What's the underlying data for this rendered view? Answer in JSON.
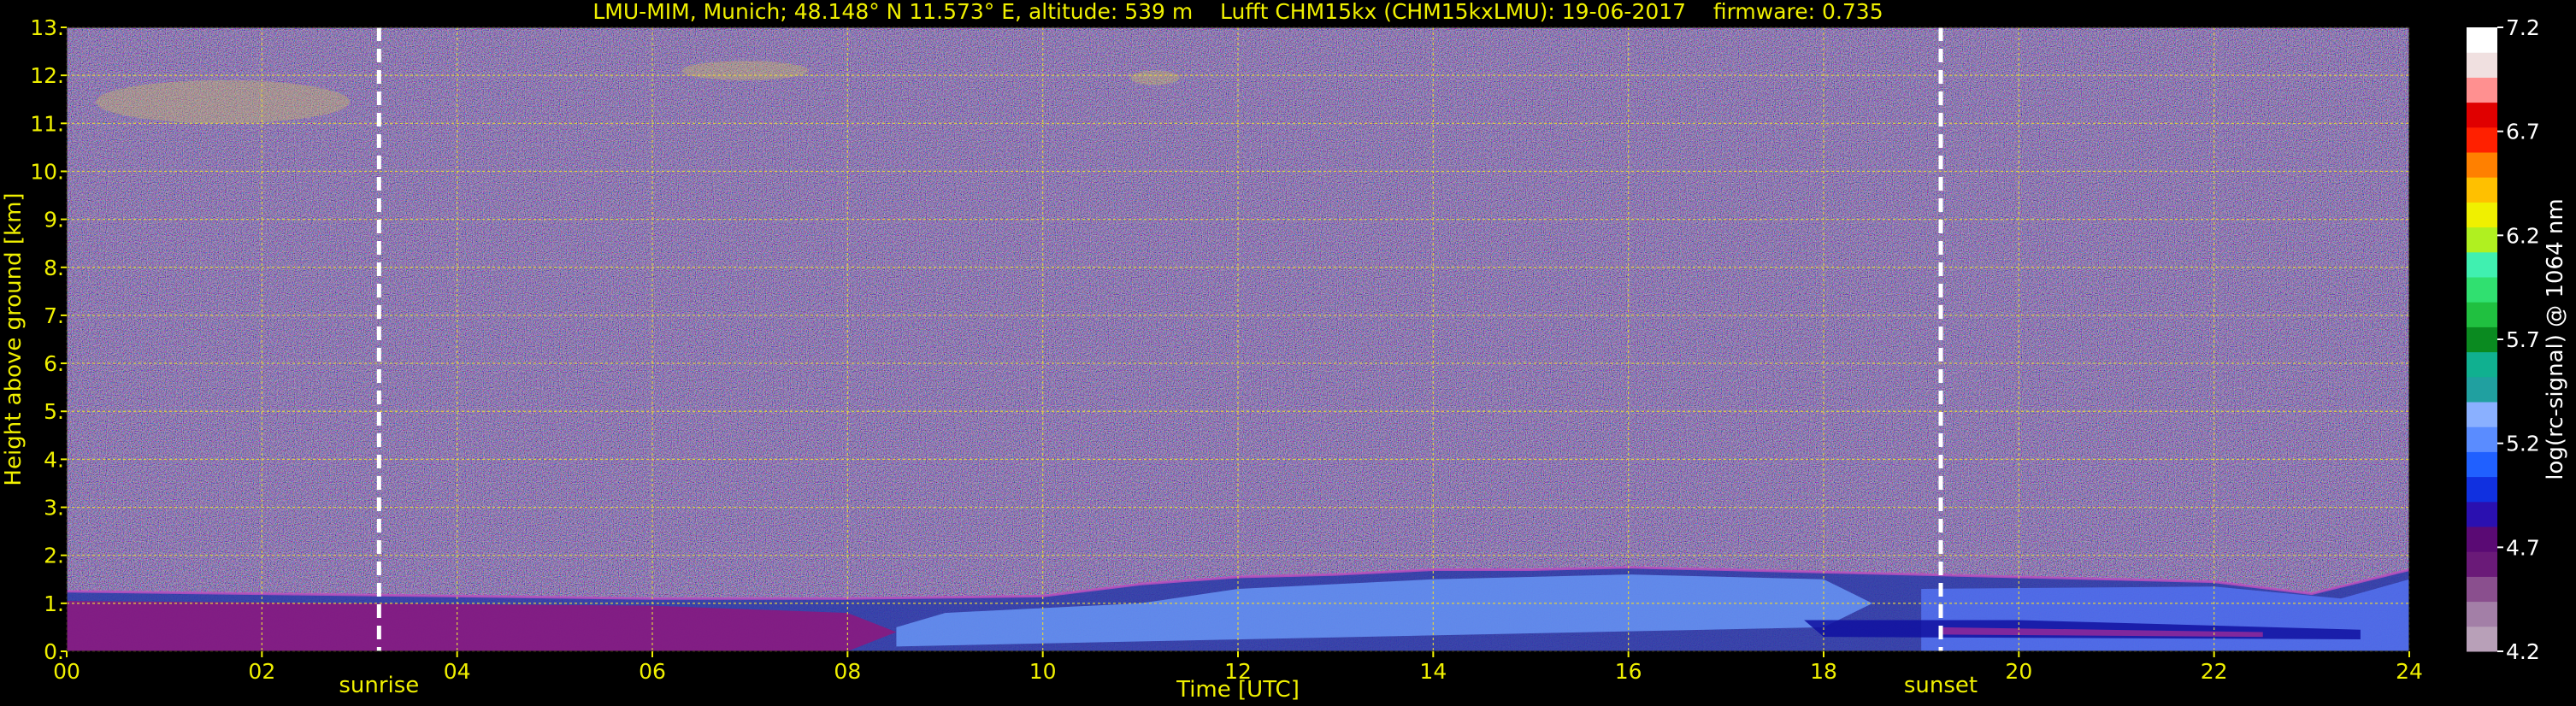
{
  "chart_data": {
    "type": "heatmap",
    "title": "LMU-MIM, Munich; 48.148° N 11.573° E, altitude: 539 m    Lufft CHM15kx (CHM15kxLMU): 19-06-2017    firmware: 0.735",
    "xlabel": "Time [UTC]",
    "ylabel": "Height above ground [km]",
    "xlim": [
      0,
      24
    ],
    "ylim": [
      0,
      13
    ],
    "x_ticks": [
      "00",
      "02",
      "04",
      "06",
      "08",
      "10",
      "12",
      "14",
      "16",
      "18",
      "20",
      "22",
      "24"
    ],
    "y_ticks": [
      "0.",
      "1.",
      "2.",
      "3.",
      "4.",
      "5.",
      "6.",
      "7.",
      "8.",
      "9.",
      "10.",
      "11.",
      "12.",
      "13."
    ],
    "grid": true,
    "colorbar": {
      "label": "log(rc-signal) @ 1064 nm",
      "range": [
        4.2,
        7.2
      ],
      "ticks": [
        "4.2",
        "4.7",
        "5.2",
        "5.7",
        "6.2",
        "6.7",
        "7.2"
      ],
      "colors": [
        "#b8a0b8",
        "#a37fa7",
        "#8a4f8e",
        "#6a1a78",
        "#5a0a74",
        "#2a10b0",
        "#1030e0",
        "#2060ff",
        "#5a8cff",
        "#8ab0ff",
        "#20a0a0",
        "#10b090",
        "#0a8a20",
        "#20c040",
        "#30e070",
        "#40f0b0",
        "#b0f020",
        "#f0f000",
        "#ffc000",
        "#ff8000",
        "#ff2000",
        "#e00000",
        "#ff9090",
        "#f0e0e0",
        "#ffffff"
      ]
    },
    "annotations": [
      {
        "label": "sunrise",
        "x": 3.2
      },
      {
        "label": "sunset",
        "x": 19.2
      }
    ],
    "features": {
      "boundary_layer_top_km": [
        [
          0,
          1.25
        ],
        [
          2,
          1.2
        ],
        [
          4,
          1.15
        ],
        [
          6,
          1.1
        ],
        [
          8,
          1.1
        ],
        [
          10,
          1.15
        ],
        [
          11,
          1.4
        ],
        [
          12,
          1.55
        ],
        [
          13,
          1.6
        ],
        [
          14,
          1.7
        ],
        [
          15,
          1.7
        ],
        [
          16,
          1.75
        ],
        [
          17,
          1.7
        ],
        [
          18,
          1.65
        ],
        [
          19,
          1.6
        ],
        [
          20,
          1.55
        ],
        [
          21,
          1.5
        ],
        [
          22,
          1.45
        ],
        [
          23,
          1.2
        ],
        [
          24,
          1.7
        ]
      ],
      "cirrus_patches": [
        {
          "x": [
            0.3,
            2.9
          ],
          "y": [
            11.0,
            11.9
          ]
        },
        {
          "x": [
            6.3,
            7.6
          ],
          "y": [
            11.9,
            12.3
          ]
        },
        {
          "x": [
            10.9,
            11.4
          ],
          "y": [
            11.8,
            12.1
          ]
        }
      ]
    }
  }
}
